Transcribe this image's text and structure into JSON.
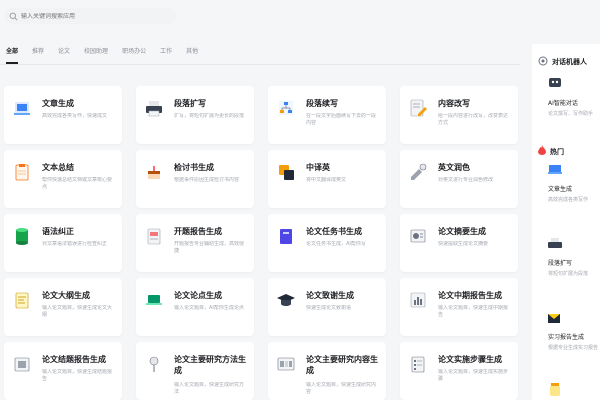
{
  "search": {
    "placeholder": "输入关键词搜索应用"
  },
  "tabs": [
    "全部",
    "推荐",
    "论文",
    "校园助理",
    "职场办公",
    "工作",
    "其他"
  ],
  "cards": [
    {
      "title": "文章生成",
      "desc": "高效完成各类写作，快速成文",
      "icon": "document-icon",
      "color": "#3b82f6"
    },
    {
      "title": "段落扩写",
      "desc": "扩写，将短句扩展为更长的段落",
      "icon": "printer-icon",
      "color": "#4b5563"
    },
    {
      "title": "段落续写",
      "desc": "在一段文字后面续写下去的一段内容",
      "icon": "network-icon",
      "color": "#3b82f6"
    },
    {
      "title": "内容改写",
      "desc": "给一段内容进行改写，改变表达方式",
      "icon": "edit-icon",
      "color": "#6b7280"
    },
    {
      "title": "文本总结",
      "desc": "帮你快速总结文档或文章核心要点",
      "icon": "clipboard-icon",
      "color": "#f97316"
    },
    {
      "title": "检讨书生成",
      "desc": "根据事件原因生成检讨书内容",
      "icon": "cake-icon",
      "color": "#b45309"
    },
    {
      "title": "中译英",
      "desc": "将中文翻译成英文",
      "icon": "translate-icon",
      "color": "#f59e0b"
    },
    {
      "title": "英文润色",
      "desc": "对英文进行专业润色修改",
      "icon": "polish-icon",
      "color": "#6b7280"
    },
    {
      "title": "语法纠正",
      "desc": "对文章语法错误进行检查纠正",
      "icon": "cylinder-icon",
      "color": "#16a34a"
    },
    {
      "title": "开题报告生成",
      "desc": "开题报告专业辅助生成，高效便捷",
      "icon": "report-icon",
      "color": "#6b7280"
    },
    {
      "title": "论文任务书生成",
      "desc": "论文任务书生成，AI帮你写",
      "icon": "book-icon",
      "color": "#4f46e5"
    },
    {
      "title": "论文摘要生成",
      "desc": "快速提取生成论文摘要",
      "icon": "summary-icon",
      "color": "#6b7280"
    },
    {
      "title": "论文大纲生成",
      "desc": "输入论文题目，快速生成论文大纲",
      "icon": "outline-icon",
      "color": "#ca8a04"
    },
    {
      "title": "论文论点生成",
      "desc": "输入论文题目，AI帮你生成论点",
      "icon": "laptop-icon",
      "color": "#059669"
    },
    {
      "title": "论文致谢生成",
      "desc": "快速生成论文致谢语",
      "icon": "graduation-cap-icon",
      "color": "#1f2937"
    },
    {
      "title": "论文中期报告生成",
      "desc": "输入论文题目，快速生成中期报告",
      "icon": "chart-icon",
      "color": "#6b7280"
    },
    {
      "title": "论文结题报告生成",
      "desc": "输入论文题目，快速生成结题报告",
      "icon": "folder-icon",
      "color": "#6b7280"
    },
    {
      "title": "论文主要研究方法生成",
      "desc": "输入论文题目，快速生成研究方法",
      "icon": "pin-icon",
      "color": "#6b7280"
    },
    {
      "title": "论文主要研究内容生成",
      "desc": "输入论文题目，快速生成研究内容",
      "icon": "gallery-icon",
      "color": "#6b7280"
    },
    {
      "title": "论文实施步骤生成",
      "desc": "输入论文题目，快速生成实施步骤",
      "icon": "steps-icon",
      "color": "#6b7280"
    }
  ],
  "sidebar": {
    "chat": {
      "title": "对话机器人",
      "item_title": "AI智能对话",
      "item_desc": "论文撰写、写作助手"
    },
    "hot": {
      "title": "热门",
      "items": [
        {
          "title": "文章生成",
          "desc": "高效完成各类写作"
        },
        {
          "title": "段落扩写",
          "desc": "将短句扩展为段落"
        },
        {
          "title": "实习报告生成",
          "desc": "根据专业生成实习报告"
        }
      ]
    }
  }
}
